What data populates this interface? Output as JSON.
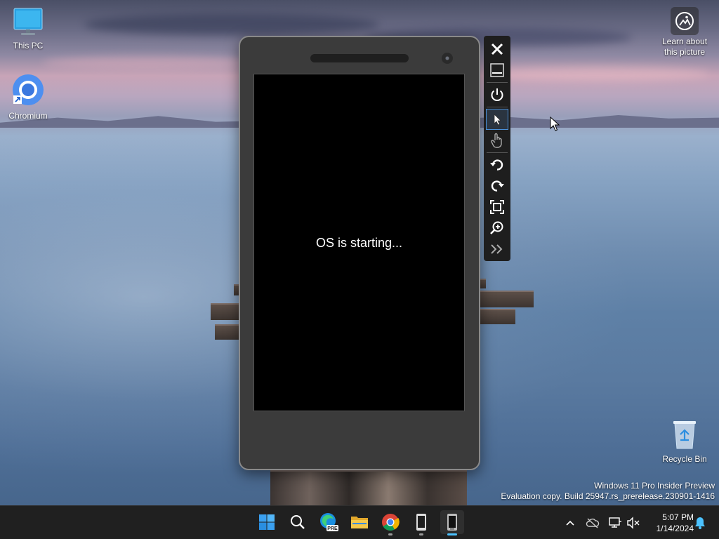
{
  "desktop": {
    "icons": [
      {
        "label": "This PC"
      },
      {
        "label": "Chromium"
      },
      {
        "label": "Recycle Bin"
      }
    ],
    "learn_about": {
      "line1": "Learn about",
      "line2": "this picture"
    },
    "watermark": {
      "line1": "Windows 11 Pro Insider Preview",
      "line2": "Evaluation copy. Build 25947.rs_prerelease.230901-1416"
    }
  },
  "emulator": {
    "screen_text": "OS is starting...",
    "toolbar": [
      {
        "name": "close-icon"
      },
      {
        "name": "minimize-icon"
      },
      {
        "name": "power-icon"
      },
      {
        "name": "pointer-icon",
        "active": true
      },
      {
        "name": "touch-hand-icon"
      },
      {
        "name": "rotate-left-icon"
      },
      {
        "name": "rotate-right-icon"
      },
      {
        "name": "fit-screen-icon"
      },
      {
        "name": "zoom-icon"
      },
      {
        "name": "more-tools-icon"
      }
    ]
  },
  "taskbar": {
    "pinned": [
      {
        "name": "start-icon"
      },
      {
        "name": "search-icon"
      },
      {
        "name": "edge-preview-icon",
        "badge": "PRE"
      },
      {
        "name": "file-explorer-icon"
      },
      {
        "name": "chrome-icon"
      },
      {
        "name": "phone-app-icon"
      },
      {
        "name": "emulator-phone-icon",
        "focused": true
      }
    ],
    "tray": [
      "chevron-up-icon",
      "cloud-off-icon",
      "network-icon",
      "volume-muted-icon"
    ],
    "clock": {
      "time": "5:07 PM",
      "date": "1/14/2024"
    },
    "notification_icon": "bell-icon"
  },
  "colors": {
    "accent": "#4cc2ff",
    "taskbar": "#202020",
    "emulator_body": "#3b3b3b",
    "toolbar": "#1e1e1e"
  }
}
